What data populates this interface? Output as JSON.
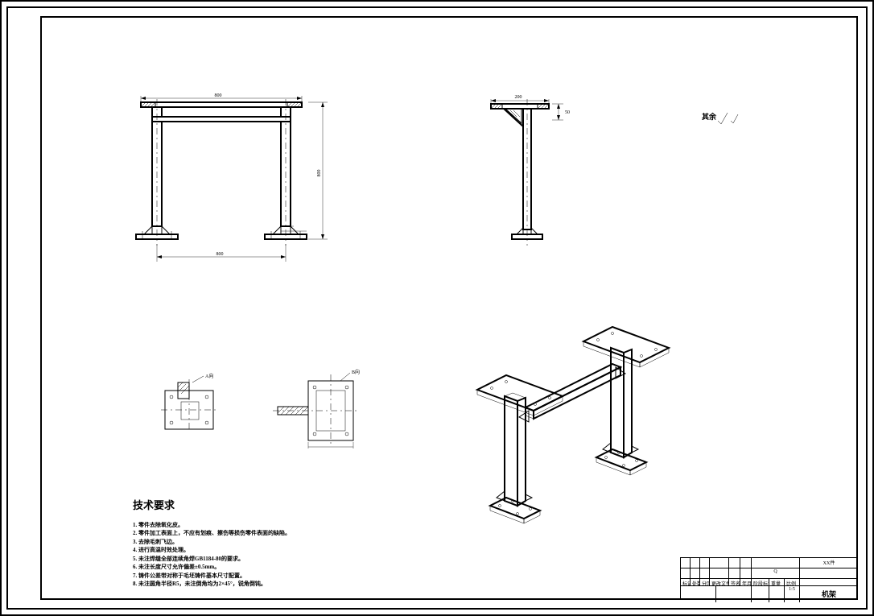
{
  "finish_symbol_label": "其余",
  "notes": {
    "title": "技术要求",
    "items": [
      "1. 零件去除氧化皮。",
      "2. 零件加工表面上，不应有划痕、擦伤等损伤零件表面的缺陷。",
      "3. 去除毛刺飞边。",
      "4. 进行高温时效处理。",
      "5. 未注焊缝全部连续角焊GB1184-80的要求。",
      "6. 未注长度尺寸允许偏差±0.5mm。",
      "7. 铸件公差带对称于毛坯铸件基本尺寸配置。",
      "8. 未注圆角半径R5，未注倒角均为2×45°，锐角倒钝。"
    ]
  },
  "views": {
    "front": {
      "top_beam_dim": "800",
      "base_width_dim": "800",
      "height_dim": "800"
    },
    "side": {
      "top_plate_width": "200",
      "offset_dim": "50"
    },
    "detail_top": {
      "label_a": "A向",
      "label_b": "B向"
    }
  },
  "titleblock": {
    "top_right": "XX件",
    "material": "Q",
    "drawing_name": "机架",
    "row_labels": [
      "标记",
      "处数",
      "分区",
      "更改文件号",
      "签名",
      "年月日",
      "阶段标记",
      "重量",
      "比例"
    ],
    "scale": "1:5"
  }
}
